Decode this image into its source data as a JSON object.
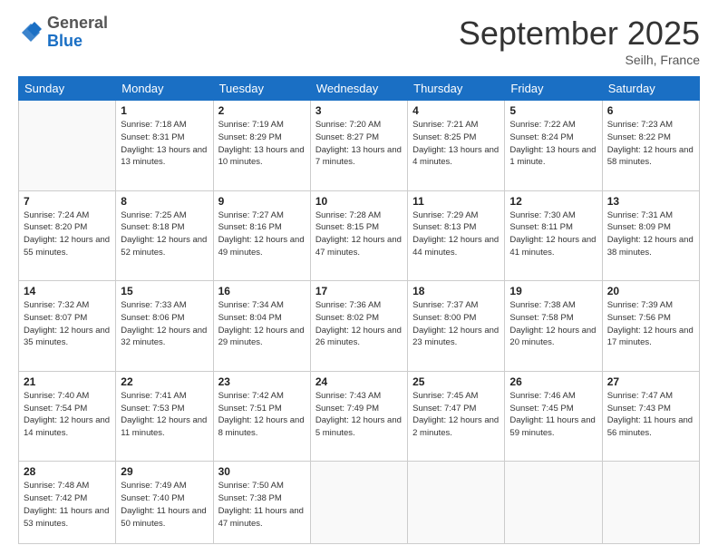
{
  "header": {
    "logo_general": "General",
    "logo_blue": "Blue",
    "month_title": "September 2025",
    "location": "Seilh, France"
  },
  "days_of_week": [
    "Sunday",
    "Monday",
    "Tuesday",
    "Wednesday",
    "Thursday",
    "Friday",
    "Saturday"
  ],
  "weeks": [
    [
      {
        "day": "",
        "sunrise": "",
        "sunset": "",
        "daylight": ""
      },
      {
        "day": "1",
        "sunrise": "Sunrise: 7:18 AM",
        "sunset": "Sunset: 8:31 PM",
        "daylight": "Daylight: 13 hours and 13 minutes."
      },
      {
        "day": "2",
        "sunrise": "Sunrise: 7:19 AM",
        "sunset": "Sunset: 8:29 PM",
        "daylight": "Daylight: 13 hours and 10 minutes."
      },
      {
        "day": "3",
        "sunrise": "Sunrise: 7:20 AM",
        "sunset": "Sunset: 8:27 PM",
        "daylight": "Daylight: 13 hours and 7 minutes."
      },
      {
        "day": "4",
        "sunrise": "Sunrise: 7:21 AM",
        "sunset": "Sunset: 8:25 PM",
        "daylight": "Daylight: 13 hours and 4 minutes."
      },
      {
        "day": "5",
        "sunrise": "Sunrise: 7:22 AM",
        "sunset": "Sunset: 8:24 PM",
        "daylight": "Daylight: 13 hours and 1 minute."
      },
      {
        "day": "6",
        "sunrise": "Sunrise: 7:23 AM",
        "sunset": "Sunset: 8:22 PM",
        "daylight": "Daylight: 12 hours and 58 minutes."
      }
    ],
    [
      {
        "day": "7",
        "sunrise": "Sunrise: 7:24 AM",
        "sunset": "Sunset: 8:20 PM",
        "daylight": "Daylight: 12 hours and 55 minutes."
      },
      {
        "day": "8",
        "sunrise": "Sunrise: 7:25 AM",
        "sunset": "Sunset: 8:18 PM",
        "daylight": "Daylight: 12 hours and 52 minutes."
      },
      {
        "day": "9",
        "sunrise": "Sunrise: 7:27 AM",
        "sunset": "Sunset: 8:16 PM",
        "daylight": "Daylight: 12 hours and 49 minutes."
      },
      {
        "day": "10",
        "sunrise": "Sunrise: 7:28 AM",
        "sunset": "Sunset: 8:15 PM",
        "daylight": "Daylight: 12 hours and 47 minutes."
      },
      {
        "day": "11",
        "sunrise": "Sunrise: 7:29 AM",
        "sunset": "Sunset: 8:13 PM",
        "daylight": "Daylight: 12 hours and 44 minutes."
      },
      {
        "day": "12",
        "sunrise": "Sunrise: 7:30 AM",
        "sunset": "Sunset: 8:11 PM",
        "daylight": "Daylight: 12 hours and 41 minutes."
      },
      {
        "day": "13",
        "sunrise": "Sunrise: 7:31 AM",
        "sunset": "Sunset: 8:09 PM",
        "daylight": "Daylight: 12 hours and 38 minutes."
      }
    ],
    [
      {
        "day": "14",
        "sunrise": "Sunrise: 7:32 AM",
        "sunset": "Sunset: 8:07 PM",
        "daylight": "Daylight: 12 hours and 35 minutes."
      },
      {
        "day": "15",
        "sunrise": "Sunrise: 7:33 AM",
        "sunset": "Sunset: 8:06 PM",
        "daylight": "Daylight: 12 hours and 32 minutes."
      },
      {
        "day": "16",
        "sunrise": "Sunrise: 7:34 AM",
        "sunset": "Sunset: 8:04 PM",
        "daylight": "Daylight: 12 hours and 29 minutes."
      },
      {
        "day": "17",
        "sunrise": "Sunrise: 7:36 AM",
        "sunset": "Sunset: 8:02 PM",
        "daylight": "Daylight: 12 hours and 26 minutes."
      },
      {
        "day": "18",
        "sunrise": "Sunrise: 7:37 AM",
        "sunset": "Sunset: 8:00 PM",
        "daylight": "Daylight: 12 hours and 23 minutes."
      },
      {
        "day": "19",
        "sunrise": "Sunrise: 7:38 AM",
        "sunset": "Sunset: 7:58 PM",
        "daylight": "Daylight: 12 hours and 20 minutes."
      },
      {
        "day": "20",
        "sunrise": "Sunrise: 7:39 AM",
        "sunset": "Sunset: 7:56 PM",
        "daylight": "Daylight: 12 hours and 17 minutes."
      }
    ],
    [
      {
        "day": "21",
        "sunrise": "Sunrise: 7:40 AM",
        "sunset": "Sunset: 7:54 PM",
        "daylight": "Daylight: 12 hours and 14 minutes."
      },
      {
        "day": "22",
        "sunrise": "Sunrise: 7:41 AM",
        "sunset": "Sunset: 7:53 PM",
        "daylight": "Daylight: 12 hours and 11 minutes."
      },
      {
        "day": "23",
        "sunrise": "Sunrise: 7:42 AM",
        "sunset": "Sunset: 7:51 PM",
        "daylight": "Daylight: 12 hours and 8 minutes."
      },
      {
        "day": "24",
        "sunrise": "Sunrise: 7:43 AM",
        "sunset": "Sunset: 7:49 PM",
        "daylight": "Daylight: 12 hours and 5 minutes."
      },
      {
        "day": "25",
        "sunrise": "Sunrise: 7:45 AM",
        "sunset": "Sunset: 7:47 PM",
        "daylight": "Daylight: 12 hours and 2 minutes."
      },
      {
        "day": "26",
        "sunrise": "Sunrise: 7:46 AM",
        "sunset": "Sunset: 7:45 PM",
        "daylight": "Daylight: 11 hours and 59 minutes."
      },
      {
        "day": "27",
        "sunrise": "Sunrise: 7:47 AM",
        "sunset": "Sunset: 7:43 PM",
        "daylight": "Daylight: 11 hours and 56 minutes."
      }
    ],
    [
      {
        "day": "28",
        "sunrise": "Sunrise: 7:48 AM",
        "sunset": "Sunset: 7:42 PM",
        "daylight": "Daylight: 11 hours and 53 minutes."
      },
      {
        "day": "29",
        "sunrise": "Sunrise: 7:49 AM",
        "sunset": "Sunset: 7:40 PM",
        "daylight": "Daylight: 11 hours and 50 minutes."
      },
      {
        "day": "30",
        "sunrise": "Sunrise: 7:50 AM",
        "sunset": "Sunset: 7:38 PM",
        "daylight": "Daylight: 11 hours and 47 minutes."
      },
      {
        "day": "",
        "sunrise": "",
        "sunset": "",
        "daylight": ""
      },
      {
        "day": "",
        "sunrise": "",
        "sunset": "",
        "daylight": ""
      },
      {
        "day": "",
        "sunrise": "",
        "sunset": "",
        "daylight": ""
      },
      {
        "day": "",
        "sunrise": "",
        "sunset": "",
        "daylight": ""
      }
    ]
  ]
}
